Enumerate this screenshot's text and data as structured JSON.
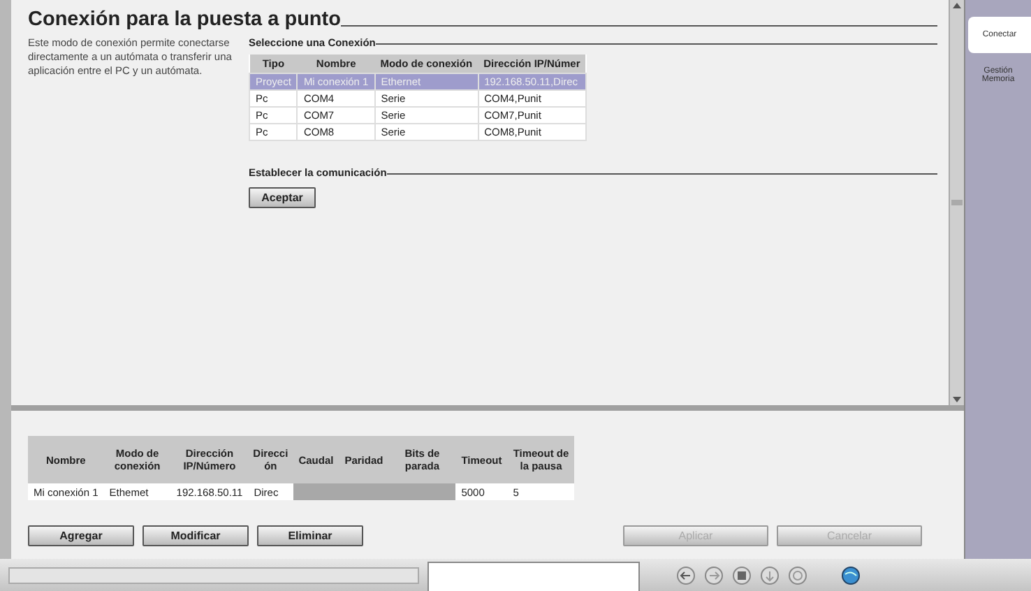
{
  "title": "Conexión para la puesta a punto",
  "description": "Este modo de conexión permite conectarse directamente a un autómata o transferir una aplicación entre el PC y un autómata.",
  "connection_section": {
    "heading": "Seleccione una Conexión",
    "columns": [
      "Tipo",
      "Nombre",
      "Modo de conexión",
      "Dirección IP/Númer"
    ],
    "rows": [
      {
        "cells": [
          "Proyect",
          "Mi conexión 1",
          "Ethernet",
          "192.168.50.11,Direc"
        ],
        "selected": true
      },
      {
        "cells": [
          "Pc",
          "COM4",
          "Serie",
          "COM4,Punit"
        ],
        "selected": false
      },
      {
        "cells": [
          "Pc",
          "COM7",
          "Serie",
          "COM7,Punit"
        ],
        "selected": false
      },
      {
        "cells": [
          "Pc",
          "COM8",
          "Serie",
          "COM8,Punit"
        ],
        "selected": false
      }
    ]
  },
  "communication_section": {
    "heading": "Establecer la comunicación",
    "button": "Aceptar"
  },
  "details_table": {
    "columns": [
      "Nombre",
      "Modo de conexión",
      "Dirección IP/Número",
      "Dirección",
      "Caudal",
      "Paridad",
      "Bits de parada",
      "Timeout",
      "Timeout de la pausa"
    ],
    "rows": [
      {
        "cells": [
          {
            "text": "Mi conexión 1",
            "disabled": false
          },
          {
            "text": "Ethemet",
            "disabled": false
          },
          {
            "text": "192.168.50.11",
            "disabled": false
          },
          {
            "text": "Direc",
            "disabled": false
          },
          {
            "disabled": true
          },
          {
            "disabled": true
          },
          {
            "disabled": true
          },
          {
            "text": "5000",
            "disabled": false
          },
          {
            "text": "5",
            "disabled": false
          }
        ]
      }
    ]
  },
  "list_buttons": [
    {
      "label": "Agregar",
      "disabled": false
    },
    {
      "label": "Modificar",
      "disabled": false
    },
    {
      "label": "Eliminar",
      "disabled": false
    }
  ],
  "dialog_buttons": [
    {
      "label": "Aplicar",
      "disabled": true
    },
    {
      "label": "Cancelar",
      "disabled": true
    }
  ],
  "side_tabs": [
    {
      "label": "Conectar",
      "selected": true
    },
    {
      "label": "Gestión Memoria",
      "selected": false
    }
  ]
}
